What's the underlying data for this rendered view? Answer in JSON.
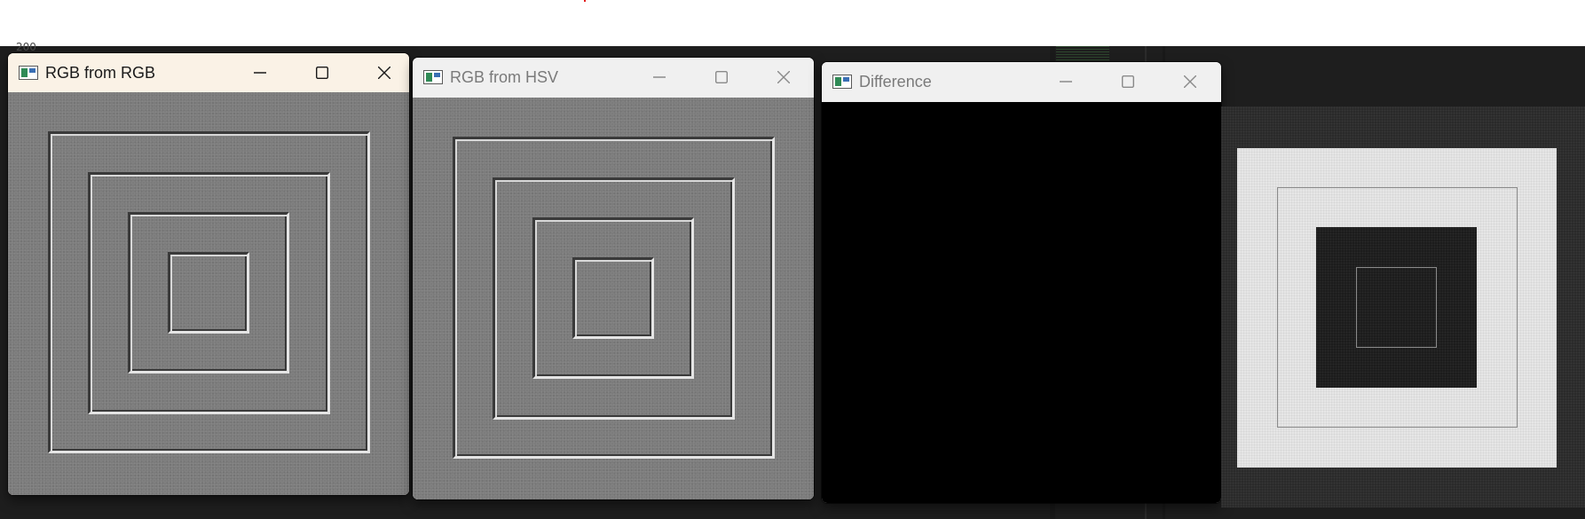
{
  "background": {
    "line_number": "200",
    "color": "#1e1e1e"
  },
  "windows": [
    {
      "title": "RGB from RGB",
      "active": true,
      "icon": "opencv-window-icon"
    },
    {
      "title": "RGB from HSV",
      "active": false,
      "icon": "opencv-window-icon"
    },
    {
      "title": "Difference",
      "active": false,
      "icon": "opencv-window-icon"
    }
  ],
  "controls": {
    "minimize": "minimize-icon",
    "maximize": "maximize-icon",
    "close": "close-icon"
  },
  "colors": {
    "active_titlebar": "#faf2e6",
    "inactive_titlebar": "#f0f0f0",
    "image_gray": "#7c7c7c",
    "difference_black": "#000000"
  }
}
